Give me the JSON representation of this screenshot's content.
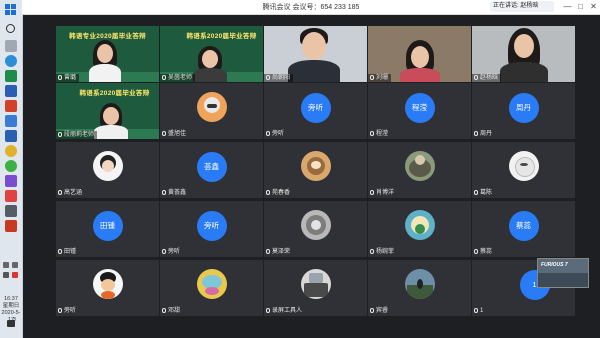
{
  "window": {
    "title": "腾讯会议 会议号：654 233 185",
    "speaking_pill": "正在讲话: 赵杨晗",
    "controls": [
      "—",
      "□",
      "✕"
    ]
  },
  "taskbar": {
    "time": "16:37",
    "weekday": "星期日",
    "date": "2020-5-17",
    "notification_badge": "3"
  },
  "participants": [
    {
      "name": "曾璐",
      "kind": "video-slide"
    },
    {
      "name": "吴茵老师",
      "kind": "video-slide"
    },
    {
      "name": "尚朝阳",
      "kind": "video"
    },
    {
      "name": "刘珊",
      "kind": "video"
    },
    {
      "name": "赵杨晗",
      "kind": "video"
    },
    {
      "name": "段丽莉老师",
      "kind": "video-slide"
    },
    {
      "name": "盛旭佳",
      "kind": "avatar"
    },
    {
      "name": "旁听",
      "kind": "circle",
      "circle_text": "旁听"
    },
    {
      "name": "程滢",
      "kind": "circle",
      "circle_text": "程滢"
    },
    {
      "name": "周丹",
      "kind": "circle",
      "circle_text": "周丹"
    },
    {
      "name": "高艺涵",
      "kind": "avatar"
    },
    {
      "name": "黄荟鑫",
      "kind": "circle",
      "circle_text": "荟鑫"
    },
    {
      "name": "苑春香",
      "kind": "avatar"
    },
    {
      "name": "肖博洋",
      "kind": "avatar"
    },
    {
      "name": "葛陈",
      "kind": "avatar"
    },
    {
      "name": "田锺",
      "kind": "circle",
      "circle_text": "田锺"
    },
    {
      "name": "旁听",
      "kind": "circle",
      "circle_text": "旁听"
    },
    {
      "name": "莫泽荣",
      "kind": "avatar"
    },
    {
      "name": "杨婉菲",
      "kind": "avatar"
    },
    {
      "name": "蔡蕊",
      "kind": "circle",
      "circle_text": "蔡蕊"
    },
    {
      "name": "旁听",
      "kind": "avatar"
    },
    {
      "name": "邓甜",
      "kind": "avatar"
    },
    {
      "name": "录屏工具人",
      "kind": "avatar"
    },
    {
      "name": "宾睿",
      "kind": "avatar"
    },
    {
      "name": "1",
      "kind": "circle",
      "circle_text": "1"
    }
  ],
  "slide": {
    "title_1": "韩语专业2020届毕业答辩",
    "title_2": "韩语系2020届毕业答辩"
  },
  "selfview": {
    "brand": "FURIOUS 7"
  },
  "colors": {
    "accent_blue": "#2a7cf6",
    "tile_bg": "#2f3136",
    "window_bg": "#1e1f22"
  }
}
